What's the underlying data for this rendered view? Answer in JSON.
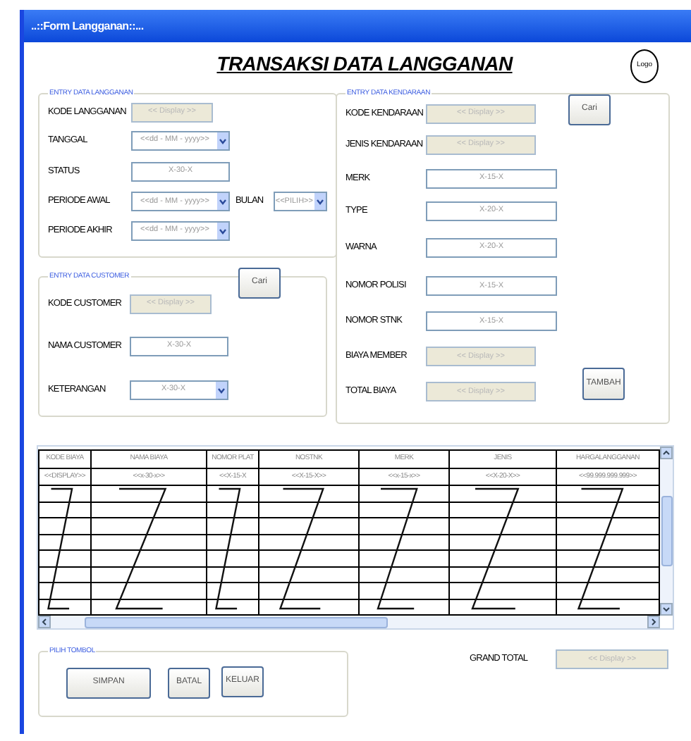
{
  "window": {
    "title": "..::Form Langganan::..."
  },
  "heading": "TRANSAKSI DATA LANGGANAN",
  "logo": "Logo",
  "groups": [
    {
      "title": "ENTRY DATA LANGGANAN",
      "rows": [
        {
          "label": "KODE LANGGANAN",
          "field": {
            "kind": "display",
            "value": "<< Display >>"
          }
        },
        {
          "label": "TANGGAL",
          "field": {
            "kind": "combo",
            "value": "<<dd - MM - yyyy>>"
          }
        },
        {
          "label": "STATUS",
          "field": {
            "kind": "text",
            "value": "X-30-X"
          }
        },
        {
          "label": "PERIODE AWAL",
          "field": {
            "kind": "combo",
            "value": "<<dd - MM - yyyy>>"
          },
          "extra": {
            "label": "BULAN",
            "field": {
              "kind": "combo",
              "value": "<<PILIH>>"
            }
          }
        },
        {
          "label": "PERIODE AKHIR",
          "field": {
            "kind": "combo",
            "value": "<<dd - MM - yyyy>>"
          }
        }
      ]
    },
    {
      "title": "ENTRY DATA CUSTOMER",
      "rows": [
        {
          "label": "KODE CUSTOMER",
          "field": {
            "kind": "display",
            "value": "<< Display >>"
          },
          "button": {
            "label": "Cari"
          }
        },
        {
          "label": "NAMA CUSTOMER",
          "field": {
            "kind": "text",
            "value": "X-30-X"
          }
        },
        {
          "label": "KETERANGAN",
          "field": {
            "kind": "combo",
            "value": "X-30-X"
          }
        }
      ]
    },
    {
      "title": "ENTRY DATA KENDARAAN",
      "rows": [
        {
          "label": "KODE KENDARAAN",
          "field": {
            "kind": "display",
            "value": "<< Display >>"
          },
          "button": {
            "label": "Cari"
          }
        },
        {
          "label": "JENIS KENDARAAN",
          "field": {
            "kind": "display",
            "value": "<< Display >>"
          }
        },
        {
          "label": "MERK",
          "field": {
            "kind": "text",
            "value": "X-15-X"
          }
        },
        {
          "label": "TYPE",
          "field": {
            "kind": "text",
            "value": "X-20-X"
          }
        },
        {
          "label": "WARNA",
          "field": {
            "kind": "text",
            "value": "X-20-X"
          }
        },
        {
          "label": "NOMOR POLISI",
          "field": {
            "kind": "text",
            "value": "X-15-X"
          }
        },
        {
          "label": "NOMOR STNK",
          "field": {
            "kind": "text",
            "value": "X-15-X"
          }
        },
        {
          "label": "BIAYA MEMBER",
          "field": {
            "kind": "display",
            "value": "<< Display >>"
          }
        },
        {
          "label": "TOTAL BIAYA",
          "field": {
            "kind": "display",
            "value": "<< Display >>"
          }
        }
      ],
      "action": {
        "label": "TAMBAH"
      }
    }
  ],
  "table": {
    "columns": [
      "KODE BIAYA",
      "NAMA BIAYA",
      "NOMOR PLAT",
      "NOSTNK",
      "MERK",
      "JENIS",
      "HARGALANGGANAN"
    ],
    "rows": [
      [
        "<<DISPLAY>>",
        "<<x-30-x>>",
        "<<X-15-X",
        "<<X-15-X>>",
        "<<x-15-x>>",
        "<<X-20-X>>",
        "<<99.999.999.999>>"
      ]
    ]
  },
  "buttons_group": {
    "title": "PILIH TOMBOL",
    "buttons": [
      {
        "label": "SIMPAN"
      },
      {
        "label": "BATAL"
      },
      {
        "label": "KELUAR"
      }
    ]
  },
  "grand_total": {
    "label": "GRAND TOTAL",
    "field": {
      "kind": "display",
      "value": "<< Display >>"
    }
  }
}
